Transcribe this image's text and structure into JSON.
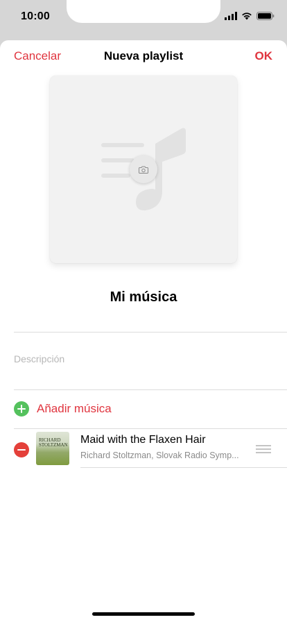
{
  "status_bar": {
    "time": "10:00",
    "icons": [
      "cellular-signal-icon",
      "wifi-icon",
      "battery-icon"
    ]
  },
  "nav": {
    "cancel_label": "Cancelar",
    "title": "Nueva playlist",
    "ok_label": "OK"
  },
  "artwork": {
    "placeholder_icon": "music-note-icon",
    "camera_icon": "camera-icon"
  },
  "playlist": {
    "name": "Mi música",
    "description_placeholder": "Descripción"
  },
  "add_music": {
    "label": "Añadir música",
    "icon": "plus-circle-icon"
  },
  "songs": [
    {
      "title": "Maid with the Flaxen Hair",
      "artist": "Richard Stoltzman, Slovak Radio Symp...",
      "album_art_text": [
        "RICHARD",
        "STOLTZMAN"
      ]
    }
  ],
  "colors": {
    "accent": "#e0353f",
    "add_green": "#54c15d",
    "remove_red": "#e4403a",
    "placeholder_gray": "#b7b7b7"
  }
}
